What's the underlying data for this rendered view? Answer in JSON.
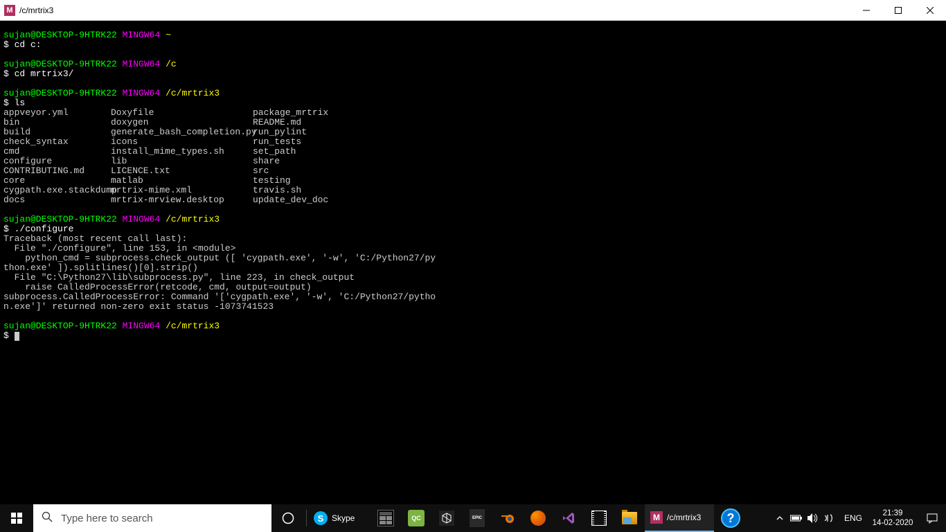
{
  "window": {
    "icon_letter": "M",
    "title": "/c/mrtrix3"
  },
  "terminal": {
    "prompt_user": "sujan@DESKTOP-9HTRK22",
    "prompt_env": "MINGW64",
    "blocks": [
      {
        "path": "~",
        "cmd": "cd c:"
      },
      {
        "path": "/c",
        "cmd": "cd mrtrix3/"
      },
      {
        "path": "/c/mrtrix3",
        "cmd": "ls",
        "ls": [
          [
            "appveyor.yml",
            "Doxyfile",
            "package_mrtrix"
          ],
          [
            "bin",
            "doxygen",
            "README.md"
          ],
          [
            "build",
            "generate_bash_completion.py",
            "run_pylint"
          ],
          [
            "check_syntax",
            "icons",
            "run_tests"
          ],
          [
            "cmd",
            "install_mime_types.sh",
            "set_path"
          ],
          [
            "configure",
            "lib",
            "share"
          ],
          [
            "CONTRIBUTING.md",
            "LICENCE.txt",
            "src"
          ],
          [
            "core",
            "matlab",
            "testing"
          ],
          [
            "cygpath.exe.stackdump",
            "mrtrix-mime.xml",
            "travis.sh"
          ],
          [
            "docs",
            "mrtrix-mrview.desktop",
            "update_dev_doc"
          ]
        ]
      },
      {
        "path": "/c/mrtrix3",
        "cmd": "./configure",
        "output": [
          "Traceback (most recent call last):",
          "  File \"./configure\", line 153, in <module>",
          "    python_cmd = subprocess.check_output ([ 'cygpath.exe', '-w', 'C:/Python27/py",
          "thon.exe' ]).splitlines()[0].strip()",
          "  File \"C:\\Python27\\lib\\subprocess.py\", line 223, in check_output",
          "    raise CalledProcessError(retcode, cmd, output=output)",
          "subprocess.CalledProcessError: Command '['cygpath.exe', '-w', 'C:/Python27/pytho",
          "n.exe']' returned non-zero exit status -1073741523"
        ]
      },
      {
        "path": "/c/mrtrix3",
        "cmd": "",
        "cursor": true
      }
    ]
  },
  "taskbar": {
    "search_placeholder": "Type here to search",
    "skype_label": "Skype",
    "active_term_label": "/c/mrtrix3",
    "lang": "ENG",
    "time": "21:39",
    "date": "14-02-2020"
  }
}
